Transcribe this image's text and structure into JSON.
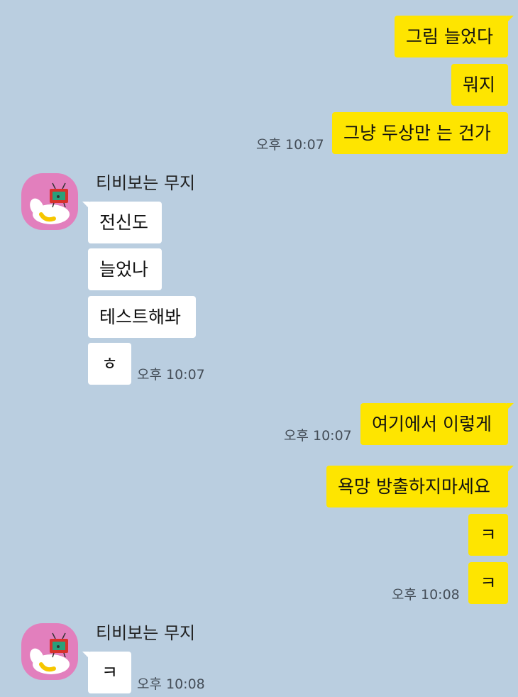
{
  "chat": {
    "sender_name": "티비보는 무지",
    "colors": {
      "background": "#bacee0",
      "my_bubble": "#fee500",
      "their_bubble": "#ffffff"
    },
    "messages": [
      {
        "side": "me",
        "text": "그림 늘었다"
      },
      {
        "side": "me",
        "text": "뭐지"
      },
      {
        "side": "me",
        "text": "그냥 두상만 는 건가",
        "time": "오후 10:07"
      },
      {
        "side": "them",
        "text": "전신도"
      },
      {
        "side": "them",
        "text": "늘었나"
      },
      {
        "side": "them",
        "text": "테스트해봐"
      },
      {
        "side": "them",
        "text": "ㅎ",
        "time": "오후 10:07"
      },
      {
        "side": "me",
        "text": "여기에서 이렇게",
        "time": "오후 10:07"
      },
      {
        "side": "me",
        "text": "욕망 방출하지마세요"
      },
      {
        "side": "me",
        "text": "ㅋ"
      },
      {
        "side": "me",
        "text": "ㅋ",
        "time": "오후 10:08"
      },
      {
        "side": "them",
        "text": "ㅋ",
        "time": "오후 10:08"
      }
    ]
  },
  "icons": {
    "avatar": "muzi-watching-tv-avatar-icon"
  }
}
